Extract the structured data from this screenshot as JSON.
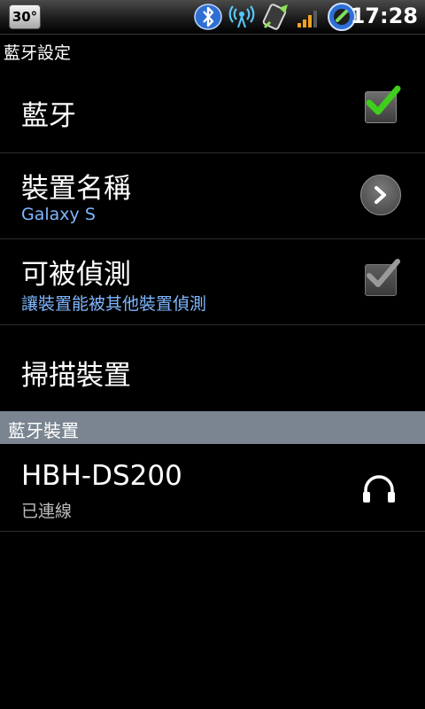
{
  "status_bar": {
    "temperature": "30°",
    "time": "17:28",
    "icons": [
      "bluetooth-icon",
      "wifi-hotspot-icon",
      "sync-icon",
      "signal-icon",
      "battery-icon"
    ]
  },
  "screen_title": "藍牙設定",
  "settings": {
    "bluetooth": {
      "title": "藍牙",
      "checked": true
    },
    "device_name": {
      "title": "裝置名稱",
      "subtitle": "Galaxy S"
    },
    "discoverable": {
      "title": "可被偵測",
      "subtitle": "讓裝置能被其他裝置偵測",
      "checked": true
    },
    "scan": {
      "title": "掃描裝置"
    }
  },
  "section": {
    "label": "藍牙裝置"
  },
  "devices": [
    {
      "name": "HBH-DS200",
      "status": "已連線",
      "icon": "headphones-icon"
    }
  ],
  "colors": {
    "accent_blue": "#7fb7ff",
    "check_green": "#3fcf1a",
    "section_header": "#7a8591"
  }
}
